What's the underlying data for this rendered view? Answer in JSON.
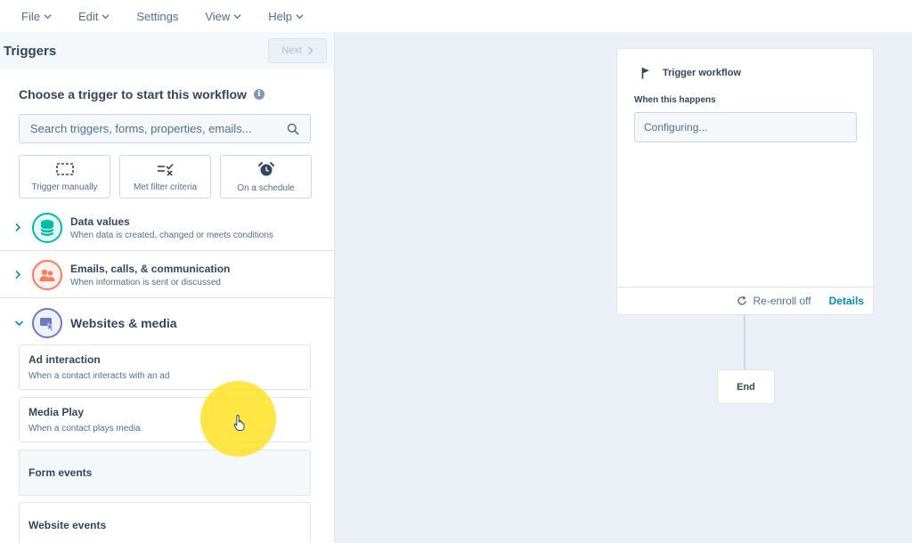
{
  "menu": {
    "items": [
      {
        "label": "File",
        "has_dropdown": true
      },
      {
        "label": "Edit",
        "has_dropdown": true
      },
      {
        "label": "Settings",
        "has_dropdown": false
      },
      {
        "label": "View",
        "has_dropdown": true
      },
      {
        "label": "Help",
        "has_dropdown": true
      }
    ]
  },
  "panel": {
    "title": "Triggers",
    "next_label": "Next",
    "heading": "Choose a trigger to start this workflow",
    "search_placeholder": "Search triggers, forms, properties, emails...",
    "quick_options": [
      {
        "label": "Trigger manually",
        "icon": "dashed-square-icon"
      },
      {
        "label": "Met filter criteria",
        "icon": "filter-check-icon"
      },
      {
        "label": "On a schedule",
        "icon": "alarm-clock-icon"
      }
    ],
    "categories": [
      {
        "title": "Data values",
        "subtitle": "When data is created, changed or meets conditions",
        "expanded": false,
        "icon": "database-icon",
        "color": "#00bda5"
      },
      {
        "title": "Emails, calls, & communication",
        "subtitle": "When information is sent or discussed",
        "expanded": false,
        "icon": "people-icon",
        "color": "#ff7a59"
      },
      {
        "title": "Websites & media",
        "subtitle": "",
        "expanded": true,
        "icon": "media-icon",
        "color": "#6a78d1"
      }
    ],
    "media_items": [
      {
        "title": "Ad interaction",
        "subtitle": "When a contact interacts with an ad"
      },
      {
        "title": "Media Play",
        "subtitle": "When a contact plays media"
      },
      {
        "title": "Form events",
        "subtitle": ""
      },
      {
        "title": "Website events",
        "subtitle": ""
      }
    ]
  },
  "canvas": {
    "trigger_card": {
      "title": "Trigger workflow",
      "label": "When this happens",
      "input_value": "Configuring...",
      "reenroll_label": "Re-enroll off",
      "details_label": "Details"
    },
    "end_label": "End"
  },
  "colors": {
    "accent_link": "#0091ae",
    "text": "#33475b",
    "cursor_highlight": "#ffe224"
  }
}
